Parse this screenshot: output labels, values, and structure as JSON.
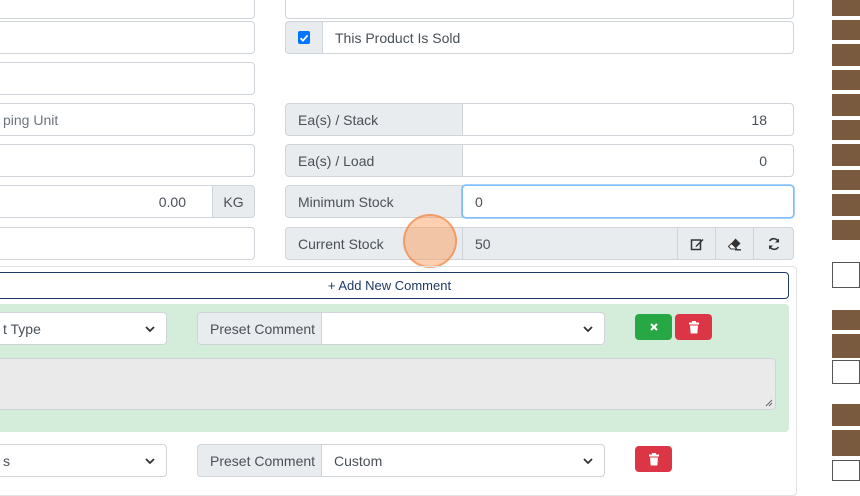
{
  "product": {
    "sold_label": "This Product Is Sold",
    "sold_checked": true,
    "shipping_unit_placeholder": "ping Unit",
    "weight_value": "0.00",
    "weight_unit": "KG",
    "ea_stack_label": "Ea(s) / Stack",
    "ea_stack_value": "18",
    "ea_load_label": "Ea(s) / Load",
    "ea_load_value": "0",
    "min_stock_label": "Minimum Stock",
    "min_stock_value": "0",
    "current_stock_label": "Current Stock",
    "current_stock_value": "50"
  },
  "comments": {
    "add_label": "+ Add New Comment",
    "rows": [
      {
        "type_value": "t Type",
        "preset_label": "Preset Comment",
        "preset_value": ""
      },
      {
        "type_value": "s",
        "preset_label": "Preset Comment",
        "preset_value": "Custom"
      }
    ]
  },
  "colors": {
    "success": "#28a745",
    "danger": "#dc3545",
    "comment_bg": "#d4edda",
    "primary_text": "#1f3a66"
  }
}
